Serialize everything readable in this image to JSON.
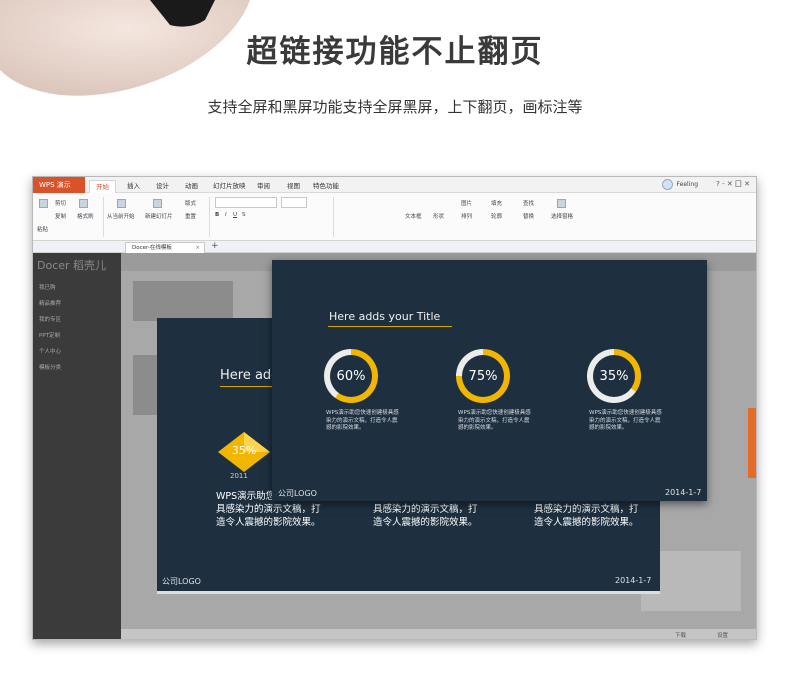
{
  "hero": {
    "title": "超链接功能不止翻页",
    "subtitle": "支持全屏和黑屏功能支持全屏黑屏，上下翻页，画标注等"
  },
  "window": {
    "app_name": "WPS 演示",
    "menus": [
      "开始",
      "插入",
      "设计",
      "动画",
      "幻灯片放映",
      "审阅",
      "视图",
      "特色功能"
    ],
    "active_menu": "开始",
    "user": "Feeling",
    "controls": "? ‑ ✕ 囗 ✕",
    "ribbon": {
      "paste": "粘贴",
      "cut": "剪切",
      "copy": "复制",
      "format_painter": "格式刷",
      "from_current": "从当前开始",
      "new_slide": "新建幻灯片",
      "layout": "版式",
      "reset": "重置",
      "text_box": "文本框",
      "shape": "形状",
      "picture": "图片",
      "arrange": "排列",
      "fill": "填充",
      "outline": "轮廓",
      "find": "查找",
      "replace": "替换",
      "select_pane": "选择窗格"
    },
    "doc_tab": "Docer-在线模板",
    "docer": {
      "logo": "Docer 稻壳儿",
      "side_items": [
        "我已购",
        "精品推荐",
        "我的专区",
        "PPT定制",
        "个人中心",
        "模板分类"
      ],
      "status_left": "下载",
      "status_right": "设置"
    }
  },
  "slide_front": {
    "title": "Here adds your Title",
    "rings": [
      {
        "label": "60%",
        "value": 60
      },
      {
        "label": "75%",
        "value": 75
      },
      {
        "label": "35%",
        "value": 35
      }
    ],
    "ring_desc": "WPS演示助您快速创建极具感染力的演示文稿，打造令人震撼的影院效果。",
    "logo": "公司LOGO",
    "date": "2014-1-7"
  },
  "slide_back": {
    "title": "Here add",
    "diamond_label": "35%",
    "year": "2011",
    "desc_1": "WPS演示助您\n具感染力的演示文稿，打\n造令人震撼的影院效果。",
    "desc_2": "具感染力的演示文稿，打\n造令人震撼的影院效果。",
    "desc_3": "具感染力的演示文稿，打\n造令人震撼的影院效果。",
    "logo": "公司LOGO",
    "date": "2014-1-7"
  },
  "colors": {
    "accent_orange": "#d9532a",
    "slide_bg": "#1e3040",
    "ring_yellow": "#f2b600"
  }
}
